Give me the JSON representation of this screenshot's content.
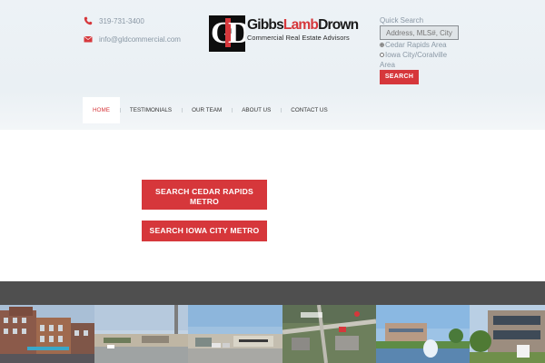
{
  "contact": {
    "phone": "319-731-3400",
    "email": "info@gldcommercial.com",
    "phone_icon": "phone-icon",
    "email_icon": "envelope-icon"
  },
  "logo": {
    "mark": "GLD",
    "name_part1": "Gibbs",
    "name_part2": "Lamb",
    "name_part3": "Drown",
    "tagline": "Commercial Real Estate Advisors"
  },
  "quick_search": {
    "title": "Quick Search",
    "placeholder": "Address, MLS#, City",
    "option1": "Cedar Rapids Area",
    "option1_selected": true,
    "option2": "Iowa City/Coralville",
    "option2_cont": "Area",
    "button": "SEARCH"
  },
  "nav": {
    "items": [
      "HOME",
      "TESTIMONIALS",
      "OUR TEAM",
      "ABOUT US",
      "CONTACT US"
    ],
    "active": "HOME"
  },
  "cta": {
    "cedar_line1": "SEARCH CEDAR RAPIDS",
    "cedar_line2": "METRO",
    "iowa": "SEARCH IOWA CITY METRO"
  },
  "colors": {
    "accent": "#d6373b",
    "header_bg": "#edf2f6",
    "band": "#4f4f4f"
  },
  "photos": [
    "downtown-brick-buildings",
    "retail-strip-center",
    "shopping-plaza",
    "aerial-map-view",
    "office-park-fountain",
    "office-building"
  ]
}
